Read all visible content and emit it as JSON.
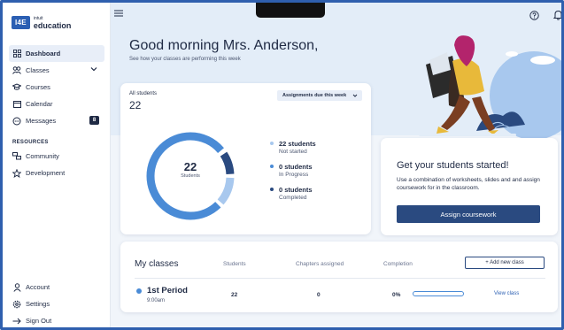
{
  "brand": {
    "badge": "I4E",
    "small": "intuit",
    "name": "education"
  },
  "sidebar": {
    "items": [
      {
        "label": "Dashboard",
        "icon": "grid-icon",
        "active": true
      },
      {
        "label": "Classes",
        "icon": "people-icon"
      },
      {
        "label": "Courses",
        "icon": "cap-icon"
      },
      {
        "label": "Calendar",
        "icon": "calendar-icon"
      },
      {
        "label": "Messages",
        "icon": "chat-icon",
        "badge": "8"
      }
    ],
    "resources_label": "RESOURCES",
    "resources": [
      {
        "label": "Community",
        "icon": "community-icon"
      },
      {
        "label": "Development",
        "icon": "star-icon"
      }
    ],
    "bottom": [
      {
        "label": "Account",
        "icon": "account-icon"
      },
      {
        "label": "Settings",
        "icon": "gear-icon"
      },
      {
        "label": "Sign Out",
        "icon": "arrow-right-icon"
      }
    ]
  },
  "header": {
    "greeting": "Good morning Mrs. Anderson,",
    "subtitle": "See how your classes are performing this week"
  },
  "stats": {
    "label": "All students",
    "total": "22",
    "filter": "Assignments due this week",
    "donut_number": "22",
    "donut_label": "Students",
    "legend": [
      {
        "main": "22 students",
        "sub": "Not started",
        "color": "#a8c8ee"
      },
      {
        "main": "0 students",
        "sub": "In Progress",
        "color": "#4a8bd6"
      },
      {
        "main": "0 students",
        "sub": "Completed",
        "color": "#2a4a80"
      }
    ]
  },
  "start_card": {
    "title": "Get your students started!",
    "text": "Use a combination of worksheets, slides and and assign coursework for in the classroom.",
    "button": "Assign coursework"
  },
  "my_classes": {
    "title": "My classes",
    "columns": [
      "Students",
      "Chapters assigned",
      "Completion"
    ],
    "add_button": "+ Add new class",
    "rows": [
      {
        "name": "1st Period",
        "time": "9:00am",
        "students": "22",
        "chapters": "0",
        "completion": "0%",
        "completion_value": 0,
        "link": "View class"
      }
    ]
  },
  "colors": {
    "accent": "#2b5fb3",
    "navy": "#2a4a80",
    "light_blue": "#a8c8ee",
    "mid_blue": "#4a8bd6"
  }
}
